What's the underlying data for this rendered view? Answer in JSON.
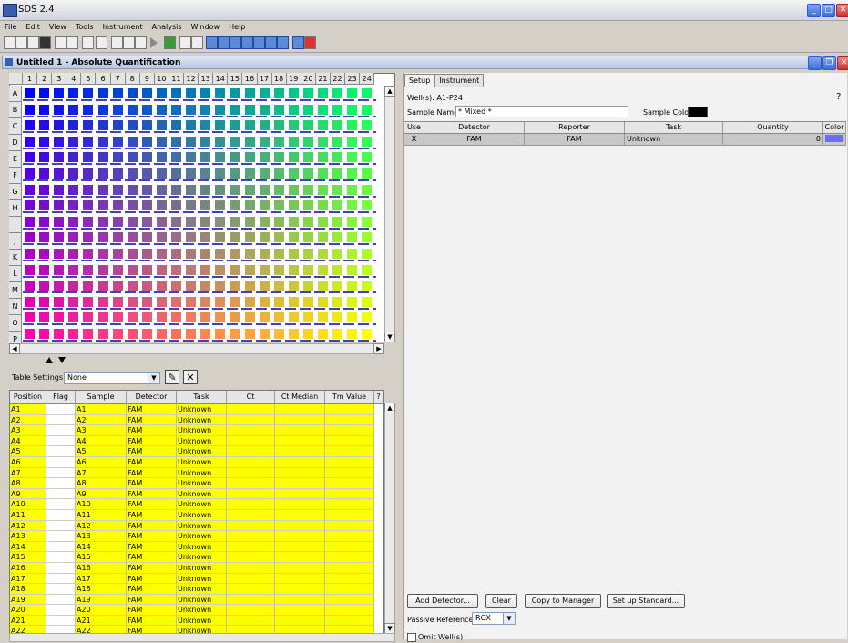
{
  "app": {
    "title": "SDS 2.4"
  },
  "menu": [
    "File",
    "Edit",
    "View",
    "Tools",
    "Instrument",
    "Analysis",
    "Window",
    "Help"
  ],
  "document": {
    "title": "Untitled 1 - Absolute Quantification"
  },
  "plate": {
    "columns": [
      "1",
      "2",
      "3",
      "4",
      "5",
      "6",
      "7",
      "8",
      "9",
      "10",
      "11",
      "12",
      "13",
      "14",
      "15",
      "16",
      "17",
      "18",
      "19",
      "20",
      "21",
      "22",
      "23",
      "24"
    ],
    "rows": [
      "A",
      "B",
      "C",
      "D",
      "E",
      "F",
      "G",
      "H",
      "I",
      "J",
      "K",
      "L",
      "M",
      "N",
      "O",
      "P"
    ]
  },
  "table_settings": {
    "label": "Table Settings:",
    "value": "None"
  },
  "well_table": {
    "headers": [
      "Position",
      "Flag",
      "Sample",
      "Detector",
      "Task",
      "Ct",
      "Ct Median",
      "Tm Value",
      "?"
    ],
    "rows": [
      {
        "pos": "A1",
        "sample": "A1",
        "detector": "FAM",
        "task": "Unknown"
      },
      {
        "pos": "A2",
        "sample": "A2",
        "detector": "FAM",
        "task": "Unknown"
      },
      {
        "pos": "A3",
        "sample": "A3",
        "detector": "FAM",
        "task": "Unknown"
      },
      {
        "pos": "A4",
        "sample": "A4",
        "detector": "FAM",
        "task": "Unknown"
      },
      {
        "pos": "A5",
        "sample": "A5",
        "detector": "FAM",
        "task": "Unknown"
      },
      {
        "pos": "A6",
        "sample": "A6",
        "detector": "FAM",
        "task": "Unknown"
      },
      {
        "pos": "A7",
        "sample": "A7",
        "detector": "FAM",
        "task": "Unknown"
      },
      {
        "pos": "A8",
        "sample": "A8",
        "detector": "FAM",
        "task": "Unknown"
      },
      {
        "pos": "A9",
        "sample": "A9",
        "detector": "FAM",
        "task": "Unknown"
      },
      {
        "pos": "A10",
        "sample": "A10",
        "detector": "FAM",
        "task": "Unknown"
      },
      {
        "pos": "A11",
        "sample": "A11",
        "detector": "FAM",
        "task": "Unknown"
      },
      {
        "pos": "A12",
        "sample": "A12",
        "detector": "FAM",
        "task": "Unknown"
      },
      {
        "pos": "A13",
        "sample": "A13",
        "detector": "FAM",
        "task": "Unknown"
      },
      {
        "pos": "A14",
        "sample": "A14",
        "detector": "FAM",
        "task": "Unknown"
      },
      {
        "pos": "A15",
        "sample": "A15",
        "detector": "FAM",
        "task": "Unknown"
      },
      {
        "pos": "A16",
        "sample": "A16",
        "detector": "FAM",
        "task": "Unknown"
      },
      {
        "pos": "A17",
        "sample": "A17",
        "detector": "FAM",
        "task": "Unknown"
      },
      {
        "pos": "A18",
        "sample": "A18",
        "detector": "FAM",
        "task": "Unknown"
      },
      {
        "pos": "A19",
        "sample": "A19",
        "detector": "FAM",
        "task": "Unknown"
      },
      {
        "pos": "A20",
        "sample": "A20",
        "detector": "FAM",
        "task": "Unknown"
      },
      {
        "pos": "A21",
        "sample": "A21",
        "detector": "FAM",
        "task": "Unknown"
      },
      {
        "pos": "A22",
        "sample": "A22",
        "detector": "FAM",
        "task": "Unknown"
      }
    ]
  },
  "setup": {
    "tabs": [
      "Setup",
      "Instrument"
    ],
    "wells_label": "Well(s): A1-P24",
    "help": "?",
    "sample_name_label": "Sample Name:",
    "sample_name_value": "* Mixed *",
    "sample_color_label": "Sample Color:",
    "detector_headers": [
      "Use",
      "Detector",
      "Reporter",
      "Task",
      "Quantity",
      "Color"
    ],
    "detector_row": {
      "use": "X",
      "detector": "FAM",
      "reporter": "FAM",
      "task": "Unknown",
      "quantity": "0",
      "color": "#6b6bff"
    },
    "buttons": {
      "add_detector": "Add Detector...",
      "clear": "Clear",
      "copy_to_manager": "Copy to Manager",
      "set_up_standard": "Set up Standard..."
    },
    "passive_reference_label": "Passive Reference:",
    "passive_reference_value": "ROX",
    "omit_wells_label": "Omit Well(s)"
  },
  "colors": {
    "well_start_top": "#0000ff",
    "well_end_top": "#00ff66",
    "well_start_bottom": "#ff00aa",
    "well_end_bottom": "#ffff00",
    "table_highlight": "#ffff00",
    "plate_line": "#4040c0"
  }
}
